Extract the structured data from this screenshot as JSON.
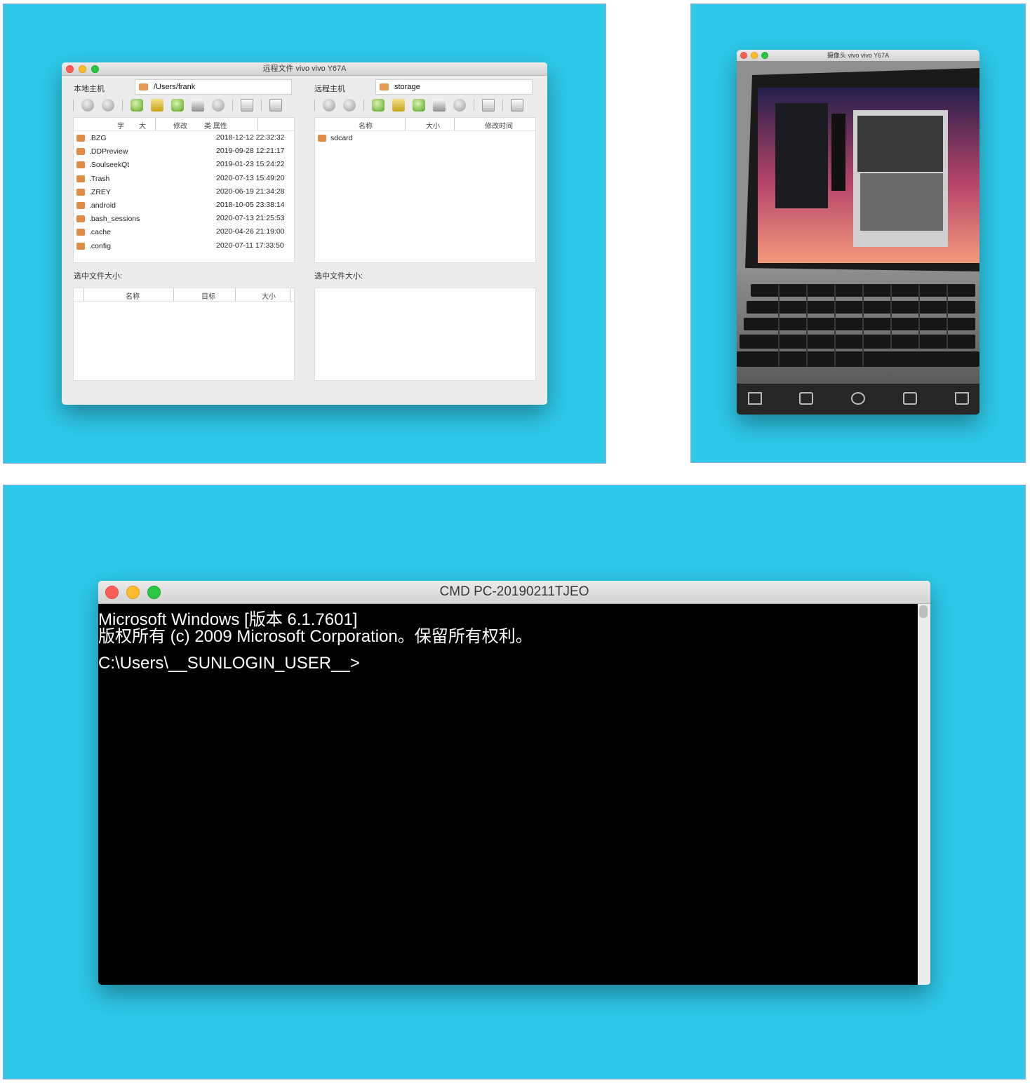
{
  "file_window": {
    "title": "远程文件 vivo vivo Y67A",
    "local": {
      "label": "本地主机",
      "path": "/Users/frank",
      "columns": [
        "字",
        "大",
        "修改",
        "类 属性"
      ],
      "files": [
        {
          "name": ".BZG",
          "modified": "2018-12-12 22:32:32"
        },
        {
          "name": ".DDPreview",
          "modified": "2019-09-28 12:21:17"
        },
        {
          "name": ".SoulseekQt",
          "modified": "2019-01-23 15:24:22"
        },
        {
          "name": ".Trash",
          "modified": "2020-07-13 15:49:20"
        },
        {
          "name": ".ZREY",
          "modified": "2020-06-19 21:34:28"
        },
        {
          "name": ".android",
          "modified": "2018-10-05 23:38:14"
        },
        {
          "name": ".bash_sessions",
          "modified": "2020-07-13 21:25:53"
        },
        {
          "name": ".cache",
          "modified": "2020-04-26 21:19:00"
        },
        {
          "name": ".config",
          "modified": "2020-07-11 17:33:50"
        }
      ],
      "selected_size_label": "选中文件大小:",
      "transfer_columns": [
        "名称",
        "目标",
        "大小"
      ]
    },
    "remote": {
      "label": "远程主机",
      "path": "storage",
      "columns": [
        "名称",
        "大小",
        "修改时间"
      ],
      "files": [
        {
          "name": "sdcard"
        }
      ],
      "selected_size_label": "选中文件大小:"
    }
  },
  "camera_window": {
    "title": "摄像头 vivo vivo Y67A",
    "tools": [
      "crop-icon",
      "camera-icon",
      "rotate-icon",
      "resize-icon",
      "flip-icon"
    ]
  },
  "cmd_window": {
    "title": "CMD PC-20190211TJEO",
    "lines": [
      "Microsoft Windows [版本 6.1.7601]",
      "版权所有 (c) 2009 Microsoft Corporation。保留所有权利。",
      "",
      "C:\\Users\\__SUNLOGIN_USER__>"
    ]
  },
  "colors": {
    "backdrop": "#2ec8e8",
    "close": "#fc5f57",
    "minimize": "#fdbc2e",
    "zoom": "#29c840"
  }
}
